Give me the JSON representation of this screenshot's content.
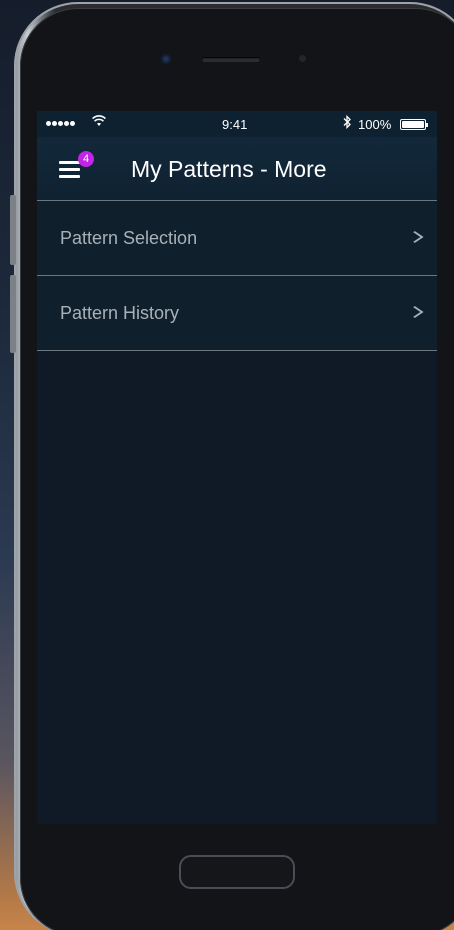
{
  "status_bar": {
    "time": "9:41",
    "battery": "100%",
    "signal_icon": "signal-dots-icon",
    "wifi_icon": "wifi-icon",
    "bluetooth_icon": "bluetooth-icon",
    "battery_icon": "battery-icon"
  },
  "nav": {
    "title": "My Patterns - More",
    "menu_icon": "hamburger-menu-icon",
    "badge_count": "4"
  },
  "list": {
    "items": [
      {
        "label": "Pattern Selection",
        "icon": "chevron-right-icon"
      },
      {
        "label": "Pattern History",
        "icon": "chevron-right-icon"
      }
    ]
  },
  "colors": {
    "badge": "#c325e6",
    "nav_background": "#12283a",
    "screen_background": "#0f1a26",
    "list_text": "#a9b1b8",
    "divider": "#6c7780"
  }
}
